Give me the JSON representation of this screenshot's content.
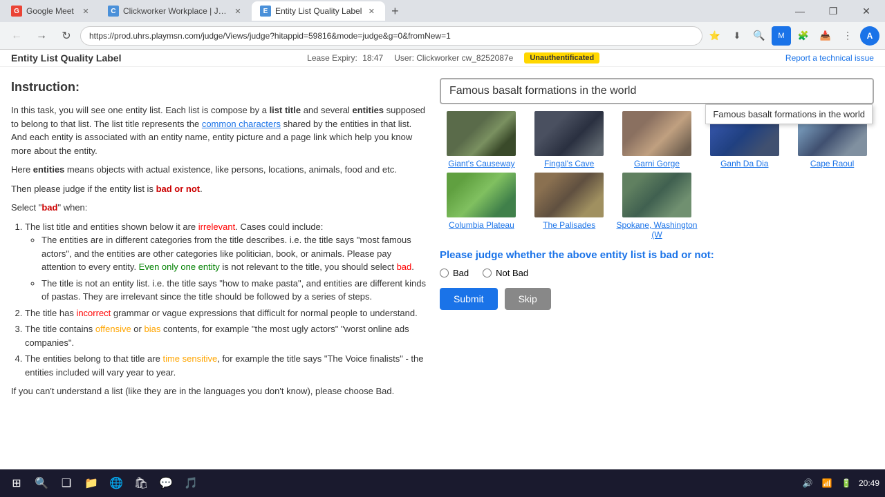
{
  "browser": {
    "tabs": [
      {
        "id": "tab1",
        "label": "Google Meet",
        "favicon_color": "#ea4335",
        "favicon_letter": "G",
        "active": false
      },
      {
        "id": "tab2",
        "label": "Clickworker Workplace | Job pro...",
        "favicon_color": "#4a90d9",
        "favicon_letter": "C",
        "active": false
      },
      {
        "id": "tab3",
        "label": "Entity List Quality Label",
        "favicon_color": "#4a90d9",
        "favicon_letter": "E",
        "active": true
      }
    ],
    "address": "https://prod.uhrs.playmsn.com/judge/Views/judge?hitappid=59816&mode=judge&g=0&fromNew=1",
    "window_controls": {
      "minimize": "—",
      "maximize": "□",
      "restore": "❐",
      "close": "✕"
    }
  },
  "app": {
    "title": "Entity List Quality Label",
    "lease_label": "Lease Expiry:",
    "lease_time": "18:47",
    "user_label": "User: Clickworker cw_8252087e",
    "auth_badge": "Unauthentificated",
    "report_link": "Report a technical issue"
  },
  "instruction": {
    "heading": "Instruction:",
    "paragraphs": {
      "intro": "In this task, you will see one entity list. Each list is compose by a list title and several entities supposed to belong to that list. The list title represents the common characters shared by the entities in that list. And each entity is associated with an entity name, entity picture and a page link which help you know more about the entity.",
      "entities_def": "Here entities means objects with actual existence, like persons, locations, animals, food and etc.",
      "judge_intro": "Then please judge if the entity list is bad or not.",
      "select_bad": "Select \"bad\" when:",
      "bad_point1": "The list title and entities shown below it are irrelevant. Cases could include:",
      "bad_point1_sub1": "The entities are in different categories from the title describes. i.e. the title says \"most famous actors\", and the entities are other categories like politician, book, or animals. Please pay attention to every entity. Even only one entity is not relevant to the title, you should select bad.",
      "bad_point1_sub2": "The title is not an entity list. i.e. the title says \"how to make pasta\", and entities are different kinds of pastas. They are irrelevant since the title should be followed by a series of steps.",
      "bad_point2": "The title has incorrect grammar or vague expressions that difficult for normal people to understand.",
      "bad_point3": "The title contains offensive or bias contents, for example \"the most ugly actors\" \"worst online ads companies\".",
      "bad_point4": "The entities belong to that title are time sensitive, for example the title says \"The Voice finalists\" - the entities included will vary year to year.",
      "footer": "If you can't understand a list (like they are in the languages you don't know), please choose Bad."
    },
    "highlights": {
      "list_title": "list title",
      "entities": "entities",
      "common_characters": "common characters",
      "entities2": "entities",
      "bad": "bad or not",
      "irrelevant": "irrelevant",
      "even_one": "Even only one entity",
      "bad_select": "bad",
      "incorrect": "incorrect",
      "offensive": "offensive",
      "bias": "bias",
      "time_sensitive": "time sensitive"
    }
  },
  "task": {
    "list_title": "Famous basalt formations in the world",
    "tooltip_text": "Famous basalt formations in the world",
    "entities": [
      {
        "id": "e1",
        "name": "Giant's Causeway",
        "img_class": "img-causeway"
      },
      {
        "id": "e2",
        "name": "Fingal's Cave",
        "img_class": "img-fingal"
      },
      {
        "id": "e3",
        "name": "Garni Gorge",
        "img_class": "img-garni"
      },
      {
        "id": "e4",
        "name": "Ganh Da Dia",
        "img_class": "img-ganh"
      },
      {
        "id": "e5",
        "name": "Cape Raoul",
        "img_class": "img-cape"
      },
      {
        "id": "e6",
        "name": "Columbia Plateau",
        "img_class": "img-columbia"
      },
      {
        "id": "e7",
        "name": "The Palisades",
        "img_class": "img-palisades"
      },
      {
        "id": "e8",
        "name": "Spokane, Washington (W",
        "img_class": "img-spokane"
      }
    ],
    "judge_question": "Please judge whether the above entity list is bad or not:",
    "radio_bad": "Bad",
    "radio_notbad": "Not Bad",
    "submit_label": "Submit",
    "skip_label": "Skip"
  },
  "taskbar": {
    "time": "20:49",
    "start_icon": "⊞",
    "search_icon": "🔍",
    "taskview_icon": "❑",
    "apps": [
      "📁",
      "📂",
      "🌐",
      "💬",
      "🎵"
    ],
    "tray": [
      "🔊",
      "📶",
      "⚡"
    ]
  }
}
